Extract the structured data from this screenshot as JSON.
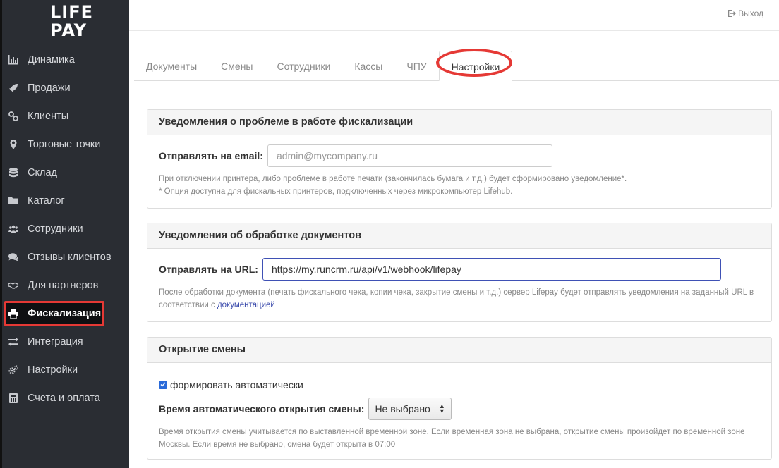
{
  "brand": {
    "logo_line1": "LIFE",
    "logo_line2": "PAY"
  },
  "header": {
    "logout_label": "Выход"
  },
  "sidebar": {
    "items": [
      {
        "label": "Динамика",
        "icon": "bar-chart-icon"
      },
      {
        "label": "Продажи",
        "icon": "rocket-icon"
      },
      {
        "label": "Клиенты",
        "icon": "link-icon"
      },
      {
        "label": "Торговые точки",
        "icon": "map-marker-icon"
      },
      {
        "label": "Склад",
        "icon": "database-icon"
      },
      {
        "label": "Каталог",
        "icon": "folder-icon"
      },
      {
        "label": "Сотрудники",
        "icon": "users-icon"
      },
      {
        "label": "Отзывы клиентов",
        "icon": "comments-icon"
      },
      {
        "label": "Для партнеров",
        "icon": "handshake-icon"
      },
      {
        "label": "Фискализация",
        "icon": "printer-icon",
        "active": true
      },
      {
        "label": "Интеграция",
        "icon": "exchange-icon"
      },
      {
        "label": "Настройки",
        "icon": "cogs-icon"
      },
      {
        "label": "Счета и оплата",
        "icon": "calculator-icon"
      }
    ]
  },
  "tabs": [
    "Документы",
    "Смены",
    "Сотрудники",
    "Кассы",
    "ЧПУ",
    "Настройки"
  ],
  "active_tab": "Настройки",
  "panels": {
    "fiscal_notify": {
      "title": "Уведомления о проблеме в работе фискализации",
      "email_label": "Отправлять на email:",
      "email_placeholder": "admin@mycompany.ru",
      "help_line1": "При отключении принтера, либо проблеме в работе печати (закончилась бумага и т.д.) будет сформировано уведомление*.",
      "help_line2": "* Опция доступна для фискальных принтеров, подключенных через микрокомпьютер Lifehub."
    },
    "doc_notify": {
      "title": "Уведомления об обработке документов",
      "url_label": "Отправлять на URL:",
      "url_value": "https://my.runcrm.ru/api/v1/webhook/lifepay",
      "help_text": "После обработки документа (печать фискального чека, копии чека, закрытие смены и т.д.) сервер Lifepay будет отправлять уведомления на заданный URL в соответствии с",
      "help_link": "документацией"
    },
    "shift_open": {
      "title": "Открытие смены",
      "auto_label": "формировать автоматически",
      "auto_checked": true,
      "time_label": "Время автоматического открытия смены:",
      "time_value": "Не выбрано",
      "help_text": "Время открытия смены учитывается по выставленной временной зоне. Если временная зона не выбрана, открытие смены произойдет по временной зоне Москвы. Если время не выбрано, смена будет открыта в 07:00"
    }
  },
  "colors": {
    "sidebar_bg": "#2a2d33",
    "highlight_red": "#e53935",
    "link_blue": "#3949ab",
    "checkbox_blue": "#2a6ad9"
  }
}
